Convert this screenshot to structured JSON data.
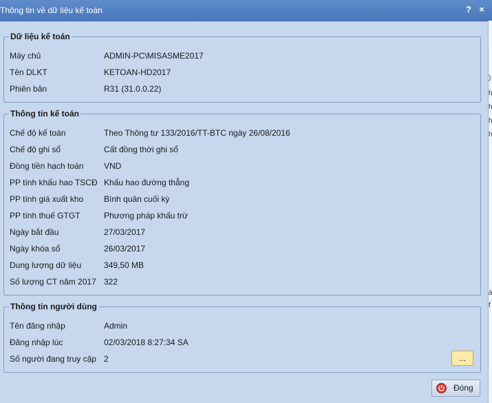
{
  "window": {
    "title": "Thông tin về dữ liệu kế toán",
    "help_label": "?",
    "close_label": "×"
  },
  "strip": [
    ")",
    "h",
    "h",
    "h",
    "h",
    "à",
    "f"
  ],
  "groups": {
    "accounting_data": {
      "title": "Dữ liệu kế toán",
      "rows": [
        {
          "label": "Máy chủ",
          "value": "ADMIN-PC\\MISASME2017"
        },
        {
          "label": "Tên DLKT",
          "value": "KETOAN-HD2017"
        },
        {
          "label": "Phiên bản",
          "value": "R31 (31.0.0.22)"
        }
      ]
    },
    "accounting_info": {
      "title": "Thông tin kế toán",
      "rows": [
        {
          "label": "Chế độ kế toán",
          "value": "Theo Thông tư 133/2016/TT-BTC ngày 26/08/2016"
        },
        {
          "label": "Chế độ ghi sổ",
          "value": "Cất đồng thời ghi sổ"
        },
        {
          "label": "Đồng tiền hạch toán",
          "value": "VND"
        },
        {
          "label": "PP tính khấu hao TSCĐ",
          "value": "Khấu hao đường thẳng"
        },
        {
          "label": "PP tính giá xuất kho",
          "value": "Bình quân cuối kỳ"
        },
        {
          "label": "PP tính thuế GTGT",
          "value": "Phương pháp khấu trừ"
        },
        {
          "label": "Ngày bắt đầu",
          "value": "27/03/2017"
        },
        {
          "label": "Ngày khóa sổ",
          "value": "26/03/2017"
        },
        {
          "label": "Dung lượng dữ liệu",
          "value": "349,50 MB"
        },
        {
          "label": "Số lượng CT năm 2017",
          "value": "322"
        }
      ]
    },
    "user_info": {
      "title": "Thông tin người dùng",
      "rows": [
        {
          "label": "Tên đăng nhập",
          "value": "Admin"
        },
        {
          "label": "Đăng nhập lúc",
          "value": "02/03/2018 8:27:34 SA"
        },
        {
          "label": "Số người đang truy cập",
          "value": "2"
        }
      ]
    }
  },
  "buttons": {
    "more_label": "...",
    "close_label": "Đóng"
  }
}
